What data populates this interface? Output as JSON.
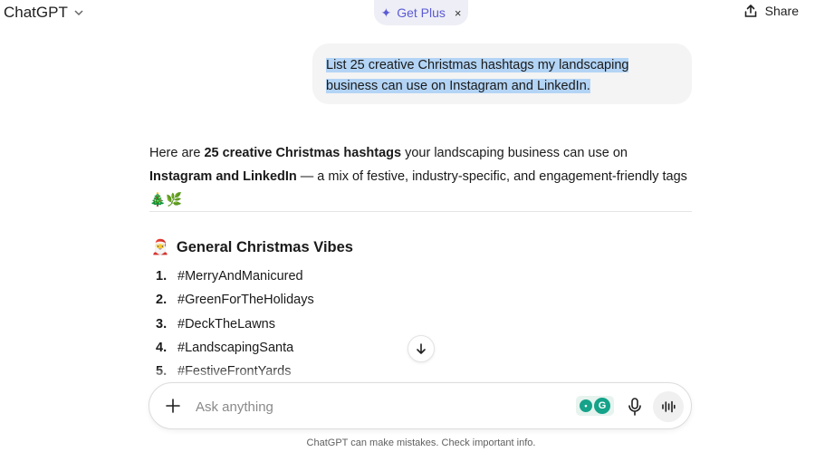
{
  "header": {
    "brand": "ChatGPT",
    "get_plus": "Get Plus",
    "close_glyph": "×",
    "share": "Share"
  },
  "user_message": "List 25 creative Christmas hashtags my landscaping business can use on Instagram and LinkedIn.",
  "answer": {
    "p1": "Here are ",
    "p1_bold": "25 creative Christmas hashtags",
    "p2": " your landscaping business can use on ",
    "p2_bold": "Instagram and LinkedIn",
    "p3": " — a mix of festive, industry-specific, and engagement-friendly tags 🎄🌿"
  },
  "section": {
    "emoji": "🎅",
    "title": "General Christmas Vibes"
  },
  "hashtags": [
    {
      "num": "1.",
      "tag": "#MerryAndManicured"
    },
    {
      "num": "2.",
      "tag": "#GreenForTheHolidays"
    },
    {
      "num": "3.",
      "tag": "#DeckTheLawns"
    },
    {
      "num": "4.",
      "tag": "#LandscapingSanta"
    },
    {
      "num": "5.",
      "tag": "#FestiveFrontYards"
    }
  ],
  "composer": {
    "placeholder": "Ask anything"
  },
  "disclaimer": "ChatGPT can make mistakes. Check important info.",
  "icons": {
    "brand_menu": "chevron-down-icon",
    "get_plus": "sparkle-icon",
    "share": "share-icon",
    "scroll": "arrow-down-icon",
    "attach": "plus-icon",
    "mic": "microphone-icon",
    "voice": "voice-mode-icon"
  },
  "colors": {
    "accent": "#5b5bd6",
    "selection": "#b3d4f5",
    "bubble": "#f4f4f4",
    "grammarly": "#15a38a"
  }
}
